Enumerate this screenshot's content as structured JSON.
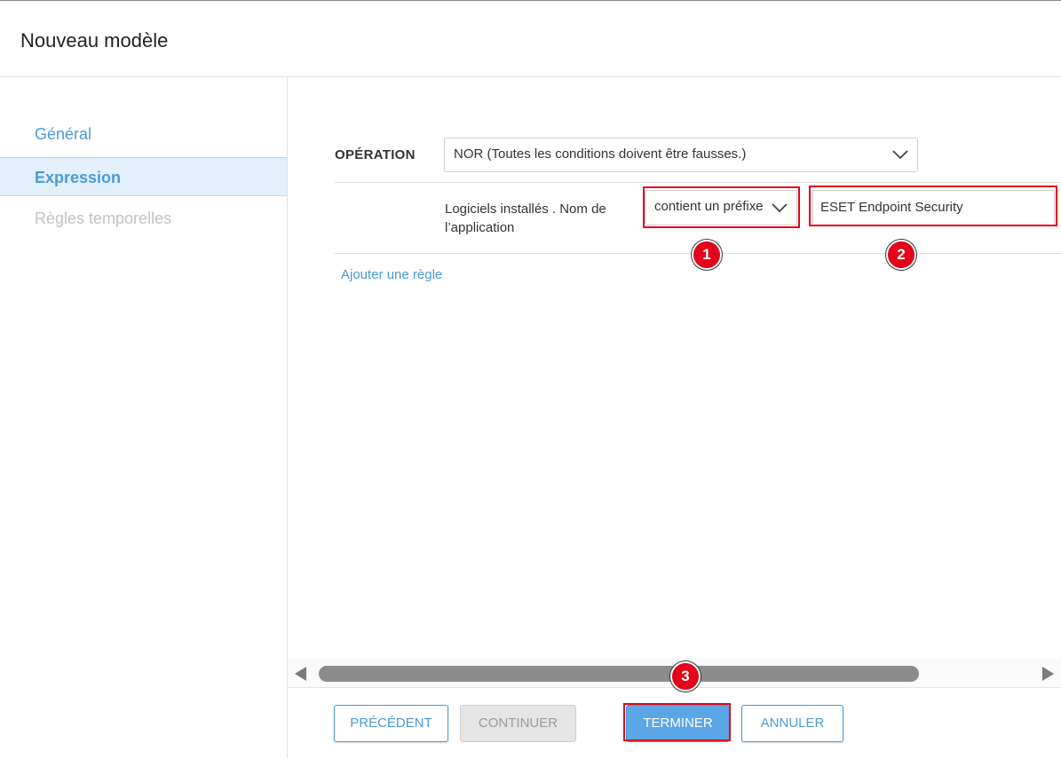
{
  "window": {
    "title": "Nouveau modèle"
  },
  "sidebar": {
    "items": [
      {
        "label": "Général",
        "state": "normal"
      },
      {
        "label": "Expression",
        "state": "active"
      },
      {
        "label": "Règles temporelles",
        "state": "disabled"
      }
    ]
  },
  "expression": {
    "operation_label": "OPÉRATION",
    "operation_value": "NOR (Toutes les conditions doivent être fausses.)",
    "rule": {
      "field_label": "Logiciels installés . Nom de l’application",
      "condition_value": "contient un préfixe",
      "text_value": "ESET Endpoint Security"
    },
    "add_rule_label": "Ajouter une règle"
  },
  "annotations": {
    "badge1": "1",
    "badge2": "2",
    "badge3": "3"
  },
  "footer": {
    "previous_label": "PRÉCÉDENT",
    "continue_label": "CONTINUER",
    "finish_label": "TERMINER",
    "cancel_label": "ANNULER"
  },
  "colors": {
    "accent": "#4a9ad9",
    "highlight": "#e3051b",
    "active_bg": "#e3f0fb"
  }
}
